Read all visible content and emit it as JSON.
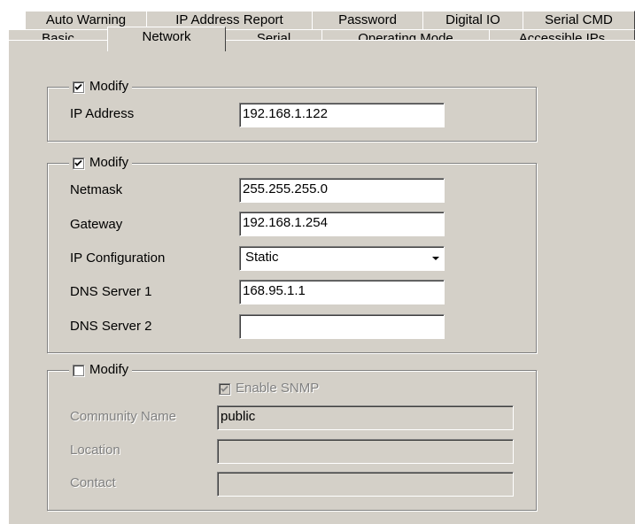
{
  "tabs_row1": [
    "Auto Warning",
    "IP Address Report",
    "Password",
    "Digital IO",
    "Serial CMD"
  ],
  "tabs_row2": [
    "Basic",
    "Network",
    "Serial",
    "Operating Mode",
    "Accessible IPs"
  ],
  "active_tab": "Network",
  "group1": {
    "modify_label": "Modify",
    "modify_checked": true,
    "ip_address_label": "IP Address",
    "ip_address_value": "192.168.1.122"
  },
  "group2": {
    "modify_label": "Modify",
    "modify_checked": true,
    "netmask_label": "Netmask",
    "netmask_value": "255.255.255.0",
    "gateway_label": "Gateway",
    "gateway_value": "192.168.1.254",
    "ipconfig_label": "IP Configuration",
    "ipconfig_value": "Static",
    "dns1_label": "DNS Server 1",
    "dns1_value": "168.95.1.1",
    "dns2_label": "DNS Server 2",
    "dns2_value": ""
  },
  "group3": {
    "modify_label": "Modify",
    "modify_checked": false,
    "enable_snmp_label": "Enable SNMP",
    "enable_snmp_checked": true,
    "community_label": "Community Name",
    "community_value": "public",
    "location_label": "Location",
    "location_value": "",
    "contact_label": "Contact",
    "contact_value": ""
  }
}
